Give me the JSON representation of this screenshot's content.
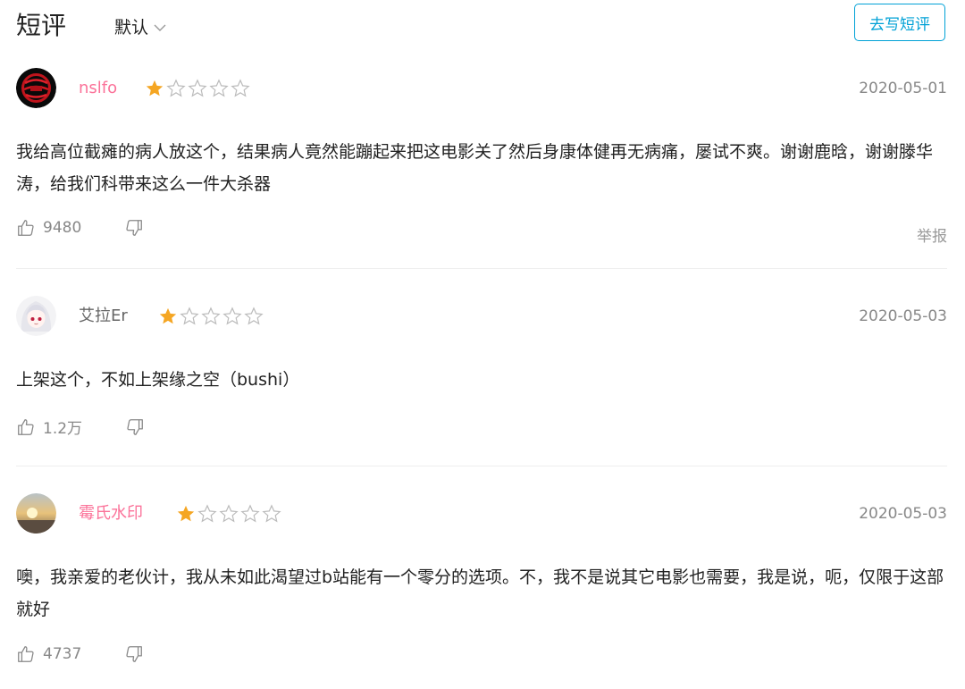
{
  "header": {
    "title": "短评",
    "sort_label": "默认",
    "write_button": "去写短评"
  },
  "colors": {
    "accent": "#00a1d6",
    "username_pink": "#fb7299",
    "star": "#f5a623"
  },
  "reviews": [
    {
      "username": "nslfo",
      "rating": 1,
      "max_rating": 5,
      "date": "2020-05-01",
      "text": "我给高位截瘫的病人放这个，结果病人竟然能蹦起来把这电影关了然后身康体健再无病痛，屡试不爽。谢谢鹿晗，谢谢滕华涛，给我们科带来这么一件大杀器",
      "likes": "9480",
      "report": "举报"
    },
    {
      "username": "艾拉Er",
      "rating": 1,
      "max_rating": 5,
      "date": "2020-05-03",
      "text": "上架这个，不如上架缘之空（bushi）",
      "likes": "1.2万"
    },
    {
      "username": "霉氏水印",
      "rating": 1,
      "max_rating": 5,
      "date": "2020-05-03",
      "text": "噢，我亲爱的老伙计，我从未如此渴望过b站能有一个零分的选项。不，我不是说其它电影也需要，我是说，呃，仅限于这部就好",
      "likes": "4737"
    }
  ]
}
